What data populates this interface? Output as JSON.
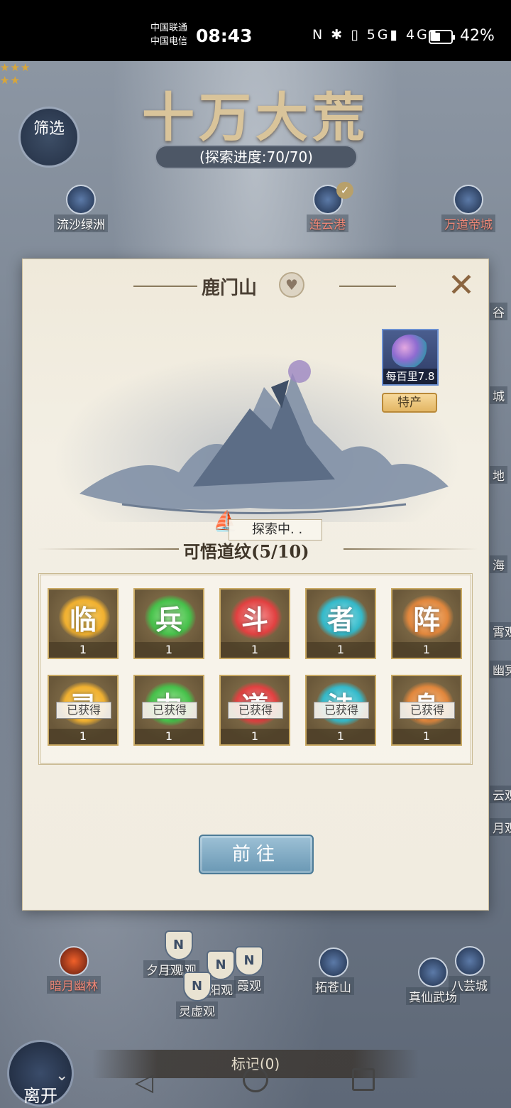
{
  "status_bar": {
    "carrier1": "中国联通",
    "carrier2": "中国电信",
    "time": "08:43",
    "icons": "N ✱ ▯ 5G▮ 4G▮",
    "battery": "42%"
  },
  "map": {
    "title": "十万大荒",
    "progress": "(探索进度:70/70)",
    "filter_label": "筛选",
    "nodes": {
      "liusha": "流沙绿洲",
      "lianyun": "连云港",
      "wandao": "万道帝城",
      "anyue": "暗月幽林",
      "wangding": "王鼎观",
      "xiyue": "夕月观",
      "yang": "阳观",
      "xia": "霞观",
      "lingxu": "灵虚观",
      "tuocang": "拓苍山",
      "zhenxian": "真仙武场",
      "bayun": "八芸城",
      "right1": "谷",
      "right2": "城",
      "right3": "地",
      "right4": "海",
      "right5": "霄观",
      "right6": "幽冥",
      "right7": "云观",
      "right8": "月观"
    },
    "stars_3": "★★★",
    "stars_2": "★★"
  },
  "dialog": {
    "title": "鹿门山",
    "exploring": "探索中. .",
    "specialty_value": "每百里7.8",
    "specialty_tag": "特产",
    "section_title": "可悟道纹(5/10)",
    "tiles_row1": [
      {
        "glyph": "临",
        "count": "1"
      },
      {
        "glyph": "兵",
        "count": "1"
      },
      {
        "glyph": "斗",
        "count": "1"
      },
      {
        "glyph": "者",
        "count": "1"
      },
      {
        "glyph": "阵",
        "count": "1"
      }
    ],
    "tiles_row2": [
      {
        "glyph": "灵",
        "count": "1",
        "status": "已获得"
      },
      {
        "glyph": "力",
        "count": "1",
        "status": "已获得"
      },
      {
        "glyph": "道",
        "count": "1",
        "status": "已获得"
      },
      {
        "glyph": "法",
        "count": "1",
        "status": "已获得"
      },
      {
        "glyph": "身",
        "count": "1",
        "status": "已获得"
      }
    ],
    "goto_label": "前往"
  },
  "bottom": {
    "leave_label": "离开",
    "mark_label": "标记(0)"
  },
  "colors": {
    "glow_gold": "#f0b030",
    "glow_green": "#46c04a",
    "glow_red": "#e04040",
    "glow_teal": "#34b8c8",
    "glow_orange": "#e0863c"
  }
}
